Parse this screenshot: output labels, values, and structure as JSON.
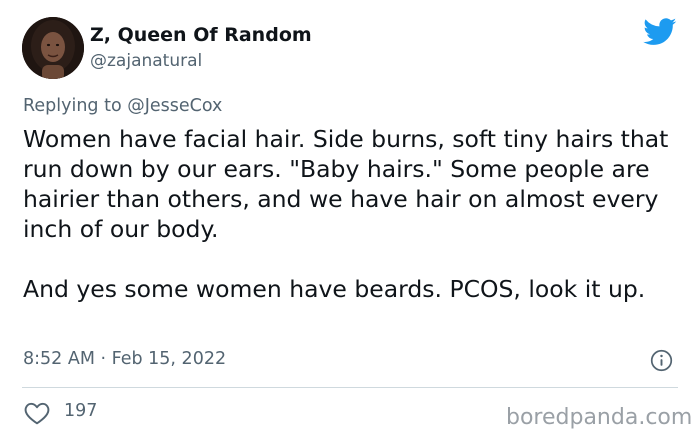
{
  "author": {
    "name": "Z, Queen Of Random",
    "handle": "@zajanatural"
  },
  "reply": {
    "prefix": "Replying to ",
    "mention": "@JesseCox"
  },
  "tweet": {
    "paragraph_1": "Women have facial hair. Side burns, soft tiny hairs that run down by our ears. \"Baby hairs.\" Some people are hairier than others, and we have hair on almost every inch of our body.",
    "paragraph_2": "And yes some women have beards. PCOS, look it up."
  },
  "meta": {
    "timestamp": "8:52 AM · Feb 15, 2022",
    "likes": "197"
  },
  "watermark": "boredpanda.com",
  "icons": {
    "logo": "twitter-bird-icon",
    "info": "info-icon",
    "like": "heart-icon"
  },
  "colors": {
    "brand": "#1d9bf0",
    "text": "#0f1419",
    "muted": "#536471"
  }
}
